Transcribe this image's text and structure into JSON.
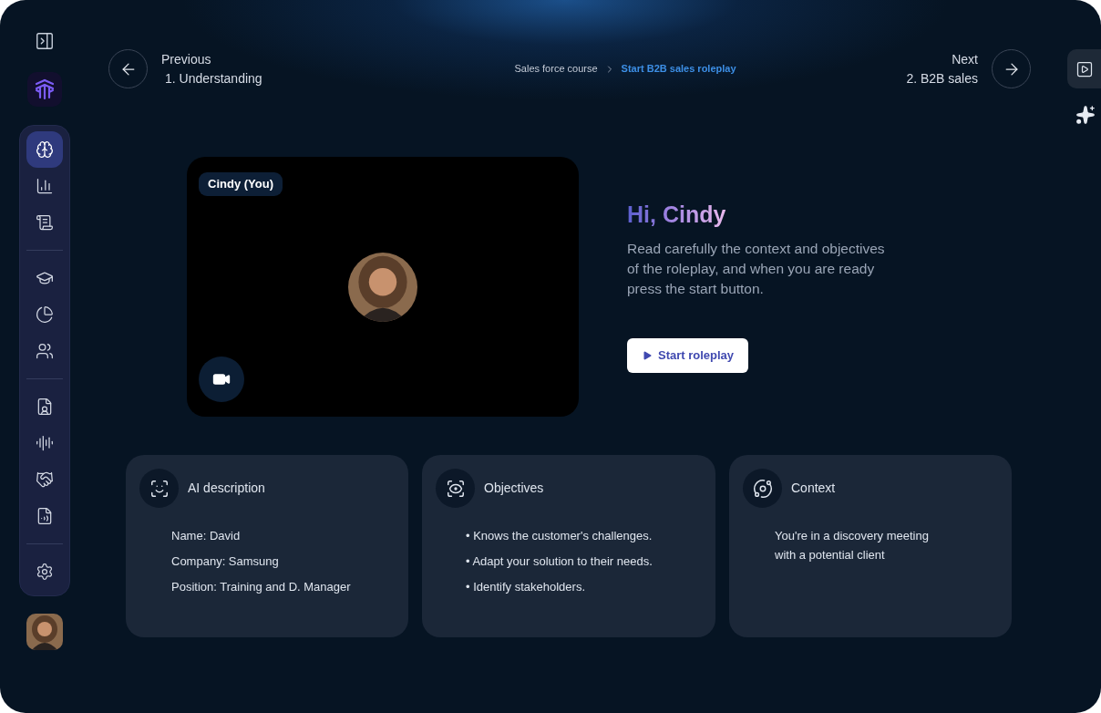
{
  "nav": {
    "previous": {
      "label": "Previous",
      "title": "1. Understanding"
    },
    "breadcrumb": [
      {
        "label": "Sales force course",
        "selected": false
      },
      {
        "label": "Start B2B sales roleplay",
        "selected": true
      }
    ],
    "next": {
      "label": "Next",
      "title": "2. B2B sales"
    }
  },
  "sidebar": {
    "groups": [
      [
        {
          "selected": true
        },
        {
          "selected": false
        },
        {
          "selected": false
        }
      ],
      [
        {
          "selected": false
        },
        {
          "selected": false
        },
        {
          "selected": false
        }
      ],
      [
        {
          "selected": false
        },
        {
          "selected": false
        },
        {
          "selected": false
        },
        {
          "selected": false
        }
      ],
      [
        {
          "selected": false
        }
      ]
    ]
  },
  "video": {
    "name_badge": "Cindy (You)",
    "camera_on": true
  },
  "greeting": {
    "title": "Hi, Cindy",
    "text": "Read carefully the context and objectives of the roleplay, and when you are ready press the start button.",
    "button": "Start roleplay"
  },
  "cards": [
    {
      "title": "AI description",
      "lines": [
        "Name: David",
        "Company: Samsung",
        "Position: Training and D. Manager"
      ]
    },
    {
      "title": "Objectives",
      "lines": [
        "• Knows the customer's challenges.",
        "• Adapt your solution to their needs.",
        "• Identify stakeholders."
      ]
    },
    {
      "title": "Context",
      "lines": [
        "You're in a discovery meeting with a potential client"
      ]
    }
  ]
}
